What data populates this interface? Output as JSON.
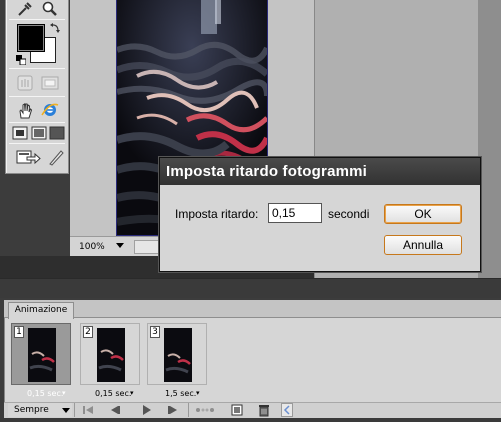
{
  "icons": {
    "tools": [
      "eyedropper-icon",
      "zoom-icon",
      "swap-colors-icon",
      "default-colors-icon",
      "hand-icon",
      "screen-mode-icon",
      "hand-tool-icon",
      "ie-browser-icon",
      "standard-mode-icon",
      "full-screen-mode-icon",
      "full-screen-icon",
      "jump-to-imageready-icon",
      "brush-icon"
    ],
    "playback": [
      "first-frame-icon",
      "previous-frame-icon",
      "play-icon",
      "next-frame-icon",
      "tween-icon",
      "duplicate-frame-icon",
      "delete-frame-icon"
    ]
  },
  "statusbar": {
    "zoom": "100%"
  },
  "dialog": {
    "title": "Imposta ritardo fotogrammi",
    "label": "Imposta ritardo:",
    "value": "0,15",
    "unit": "secondi",
    "ok_label": "OK",
    "cancel_label": "Annulla"
  },
  "animation": {
    "tab_label": "Animazione",
    "loop": "Sempre",
    "frames": [
      {
        "number": "1",
        "delay": "0,15 sec."
      },
      {
        "number": "2",
        "delay": "0,15 sec."
      },
      {
        "number": "3",
        "delay": "1,5 sec."
      }
    ]
  },
  "colors": {
    "foreground": "#000000",
    "background": "#ffffff",
    "dialog_title_bg": "#3a3a3a",
    "button_focus": "#c6781c"
  }
}
